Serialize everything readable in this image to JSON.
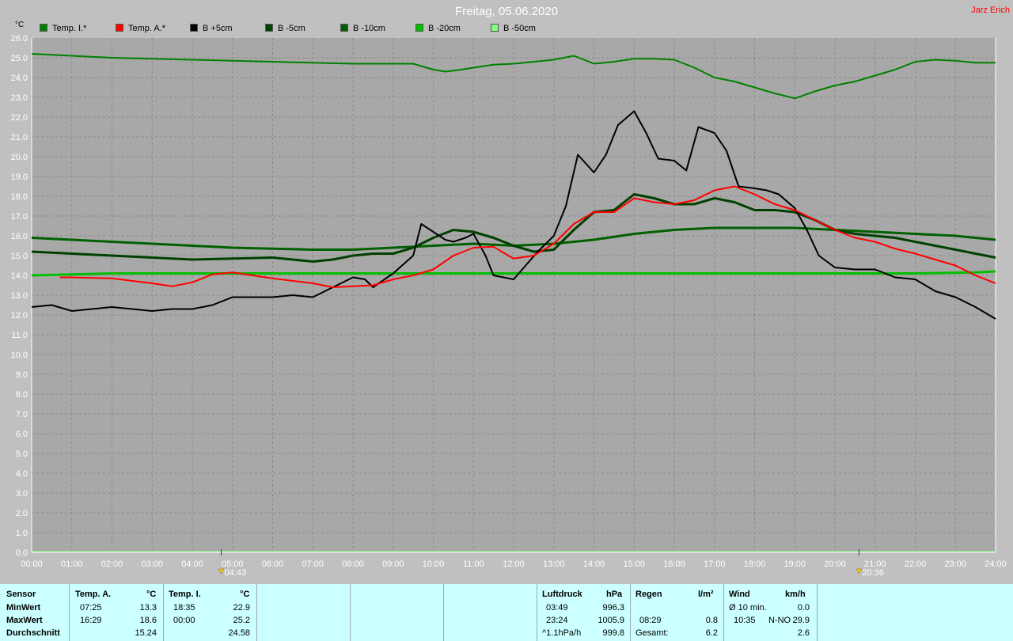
{
  "header": {
    "title": "Freitag, 05.06.2020",
    "author": "Jarz Erich",
    "unit": "°C"
  },
  "colors": {
    "background": "#c0c0c0",
    "plot_bg": "#a8a8a8",
    "grid": "#8a8a8a",
    "panel": "#ccffff"
  },
  "legend": [
    {
      "label": "Temp. I.*",
      "color": "#008000"
    },
    {
      "label": "Temp. A.*",
      "color": "#ff0000"
    },
    {
      "label": "B +5cm",
      "color": "#000000"
    },
    {
      "label": "B -5cm",
      "color": "#004000"
    },
    {
      "label": "B -10cm",
      "color": "#006000"
    },
    {
      "label": "B -20cm",
      "color": "#00c000"
    },
    {
      "label": "B -50cm",
      "color": "#80ff80"
    }
  ],
  "chart_data": {
    "type": "line",
    "title": "Freitag, 05.06.2020",
    "ylabel": "°C",
    "xlim": [
      0,
      24
    ],
    "ylim": [
      0,
      26
    ],
    "grid": true,
    "x_ticks": [
      "00:00",
      "01:00",
      "02:00",
      "03:00",
      "04:00",
      "05:00",
      "06:00",
      "07:00",
      "08:00",
      "09:00",
      "10:00",
      "11:00",
      "12:00",
      "13:00",
      "14:00",
      "15:00",
      "16:00",
      "17:00",
      "18:00",
      "19:00",
      "20:00",
      "21:00",
      "22:00",
      "23:00",
      "24:00"
    ],
    "y_ticks": [
      "0.0",
      "1.0",
      "2.0",
      "3.0",
      "4.0",
      "5.0",
      "6.0",
      "7.0",
      "8.0",
      "9.0",
      "10.0",
      "11.0",
      "12.0",
      "13.0",
      "14.0",
      "15.0",
      "16.0",
      "17.0",
      "18.0",
      "19.0",
      "20.0",
      "21.0",
      "22.0",
      "23.0",
      "24.0",
      "25.0",
      "26.0"
    ],
    "annotations": [
      {
        "label": "04:43",
        "x": 4.72,
        "kind": "sunrise"
      },
      {
        "label": "20:36",
        "x": 20.6,
        "kind": "sunset"
      }
    ],
    "series": [
      {
        "name": "Temp. I.*",
        "color": "#008000",
        "width": 2,
        "x": [
          0,
          1,
          2,
          3,
          4,
          5,
          6,
          7,
          8,
          9,
          9.5,
          10,
          10.3,
          10.7,
          11,
          11.5,
          12,
          13,
          13.5,
          14,
          14.5,
          15,
          15.5,
          16,
          16.5,
          17,
          17.5,
          18,
          18.5,
          19,
          19.5,
          20,
          20.5,
          21,
          21.5,
          22,
          22.5,
          23,
          23.5,
          24
        ],
        "y": [
          25.2,
          25.1,
          25.0,
          24.95,
          24.9,
          24.85,
          24.8,
          24.75,
          24.7,
          24.7,
          24.7,
          24.4,
          24.3,
          24.4,
          24.5,
          24.65,
          24.7,
          24.9,
          25.1,
          24.7,
          24.8,
          24.95,
          24.95,
          24.9,
          24.5,
          24.0,
          23.8,
          23.5,
          23.2,
          22.95,
          23.3,
          23.6,
          23.8,
          24.1,
          24.4,
          24.8,
          24.9,
          24.85,
          24.75,
          24.75
        ]
      },
      {
        "name": "Temp. A.*",
        "color": "#ff0000",
        "width": 2,
        "x": [
          0.7,
          1,
          2,
          3,
          3.5,
          4,
          4.5,
          5,
          5.5,
          6,
          7,
          7.5,
          8,
          8.5,
          9,
          9.5,
          10,
          10.5,
          11,
          11.5,
          12,
          12.5,
          13,
          13.5,
          14,
          14.5,
          15,
          15.5,
          16,
          16.5,
          17,
          17.5,
          18,
          18.5,
          19,
          19.5,
          20,
          20.5,
          21,
          21.5,
          22,
          22.5,
          23,
          23.5,
          24
        ],
        "y": [
          13.9,
          13.9,
          13.85,
          13.6,
          13.45,
          13.65,
          14.05,
          14.15,
          14.0,
          13.85,
          13.6,
          13.4,
          13.45,
          13.5,
          13.8,
          14.0,
          14.3,
          15.0,
          15.4,
          15.45,
          14.85,
          15.0,
          15.6,
          16.6,
          17.2,
          17.2,
          17.9,
          17.7,
          17.6,
          17.8,
          18.3,
          18.5,
          18.1,
          17.6,
          17.3,
          16.8,
          16.3,
          15.9,
          15.7,
          15.35,
          15.1,
          14.8,
          14.5,
          14.0,
          13.6
        ]
      },
      {
        "name": "B +5cm",
        "color": "#000000",
        "width": 2,
        "x": [
          0,
          0.5,
          1,
          1.5,
          2,
          2.5,
          3,
          3.5,
          4,
          4.5,
          5,
          5.5,
          6,
          6.5,
          7,
          7.5,
          8,
          8.3,
          8.5,
          9,
          9.5,
          9.7,
          10,
          10.3,
          10.5,
          10.8,
          11,
          11.3,
          11.5,
          12,
          12.3,
          12.6,
          13,
          13.3,
          13.6,
          14,
          14.3,
          14.6,
          15,
          15.3,
          15.6,
          16,
          16.3,
          16.6,
          17,
          17.3,
          17.6,
          18,
          18.3,
          18.6,
          19,
          19.3,
          19.6,
          20,
          20.5,
          21,
          21.5,
          22,
          22.5,
          23,
          23.5,
          24
        ],
        "y": [
          12.4,
          12.5,
          12.2,
          12.3,
          12.4,
          12.3,
          12.2,
          12.3,
          12.3,
          12.5,
          12.9,
          12.9,
          12.9,
          13.0,
          12.9,
          13.4,
          13.9,
          13.8,
          13.4,
          14.1,
          15.0,
          16.6,
          16.2,
          15.8,
          15.7,
          15.9,
          16.1,
          15.0,
          14.0,
          13.8,
          14.5,
          15.2,
          16.0,
          17.5,
          20.1,
          19.2,
          20.1,
          21.6,
          22.3,
          21.2,
          19.9,
          19.8,
          19.3,
          21.5,
          21.2,
          20.3,
          18.5,
          18.4,
          18.3,
          18.1,
          17.4,
          16.3,
          15.0,
          14.4,
          14.3,
          14.3,
          13.9,
          13.8,
          13.2,
          12.9,
          12.4,
          11.8
        ]
      },
      {
        "name": "B -5cm",
        "color": "#004000",
        "width": 3,
        "x": [
          0,
          1,
          2,
          3,
          4,
          5,
          6,
          7,
          7.5,
          8,
          8.5,
          9,
          9.5,
          10,
          10.5,
          11,
          11.5,
          12,
          12.5,
          13,
          13.5,
          14,
          14.5,
          15,
          15.5,
          16,
          16.5,
          17,
          17.5,
          18,
          18.5,
          19,
          19.5,
          20,
          20.5,
          21,
          21.5,
          22,
          22.5,
          23,
          23.5,
          24
        ],
        "y": [
          15.2,
          15.1,
          15.0,
          14.9,
          14.8,
          14.85,
          14.9,
          14.7,
          14.8,
          15.0,
          15.1,
          15.1,
          15.4,
          15.9,
          16.3,
          16.2,
          15.9,
          15.5,
          15.2,
          15.3,
          16.3,
          17.2,
          17.3,
          18.1,
          17.9,
          17.6,
          17.6,
          17.9,
          17.7,
          17.3,
          17.3,
          17.2,
          16.8,
          16.3,
          16.1,
          16.0,
          15.9,
          15.7,
          15.5,
          15.3,
          15.1,
          14.9
        ]
      },
      {
        "name": "B -10cm",
        "color": "#006000",
        "width": 3,
        "x": [
          0,
          1,
          2,
          3,
          4,
          5,
          6,
          7,
          8,
          9,
          10,
          11,
          12,
          13,
          14,
          15,
          16,
          17,
          18,
          19,
          20,
          21,
          22,
          23,
          24
        ],
        "y": [
          15.9,
          15.8,
          15.7,
          15.6,
          15.5,
          15.4,
          15.35,
          15.3,
          15.3,
          15.4,
          15.5,
          15.6,
          15.5,
          15.6,
          15.8,
          16.1,
          16.3,
          16.4,
          16.4,
          16.4,
          16.3,
          16.2,
          16.1,
          16.0,
          15.8
        ]
      },
      {
        "name": "B -20cm",
        "color": "#00c000",
        "width": 3,
        "x": [
          0,
          1,
          2,
          4,
          6,
          8,
          10,
          12,
          14,
          16,
          18,
          20,
          22,
          23.5,
          24
        ],
        "y": [
          14.0,
          14.05,
          14.1,
          14.1,
          14.1,
          14.1,
          14.1,
          14.1,
          14.1,
          14.1,
          14.1,
          14.1,
          14.1,
          14.15,
          14.2
        ]
      },
      {
        "name": "B -50cm",
        "color": "#80ff80",
        "width": 1,
        "x": [
          0,
          24
        ],
        "y": [
          0.05,
          0.05
        ]
      }
    ]
  },
  "stats": {
    "sensor": {
      "header": "Sensor",
      "rows": [
        "MinWert",
        "MaxWert",
        "Durchschnitt"
      ]
    },
    "temp_a": {
      "header": "Temp. A.",
      "unit": "°C",
      "min_time": "07:25",
      "min": "13.3",
      "max_time": "16:29",
      "max": "18.6",
      "avg": "15.24"
    },
    "temp_i": {
      "header": "Temp. I.",
      "unit": "°C",
      "min_time": "18:35",
      "min": "22.9",
      "max_time": "00:00",
      "max": "25.2",
      "avg": "24.58"
    },
    "pressure": {
      "header": "Luftdruck",
      "unit": "hPa",
      "r1_time": "03:49",
      "r1": "996.3",
      "r2_time": "23:24",
      "r2": "1005.9",
      "r3_time": "^1.1hPa/h",
      "r3": "999.8"
    },
    "rain": {
      "header": "Regen",
      "unit": "l/m²",
      "r2_time": "08:29",
      "r2": "0.8",
      "r3_label": "Gesamt:",
      "r3": "6.2"
    },
    "wind": {
      "header": "Wind",
      "unit": "km/h",
      "r1_label": "Ø 10 min.",
      "r1": "0.0",
      "r2_time": "10:35",
      "r2_dir": "N-NO",
      "r2": "29.9",
      "r3": "2.6"
    }
  }
}
